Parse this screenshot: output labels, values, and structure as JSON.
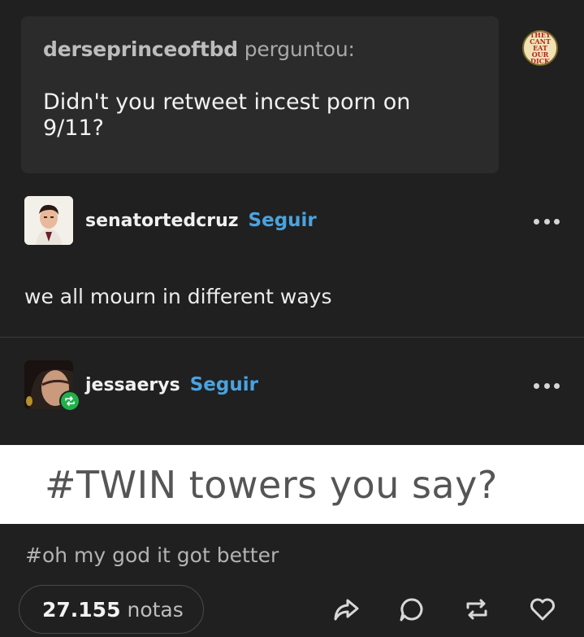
{
  "ask": {
    "asker": "derseprinceoftbd",
    "verb": "perguntou:",
    "question": "Didn't you retweet incest porn on 9/11?",
    "asker_avatar_text": "THEY CANT EAT OUR DICK"
  },
  "answer": {
    "username": "senatortedcruz",
    "follow_label": "Seguir",
    "text": "we all mourn in different ways"
  },
  "reblog": {
    "username": "jessaerys",
    "follow_label": "Seguir",
    "image_text": "#TWIN towers you say?",
    "tag": "#oh my god it got better"
  },
  "footer": {
    "notes_count": "27.155",
    "notes_label": "notas",
    "icons": [
      "share-icon",
      "reply-icon",
      "reblog-icon",
      "like-icon"
    ]
  },
  "colors": {
    "background": "#202020",
    "ask_box": "#2b2b2b",
    "follow": "#4aa3df",
    "reblog_badge": "#1fb14a"
  }
}
